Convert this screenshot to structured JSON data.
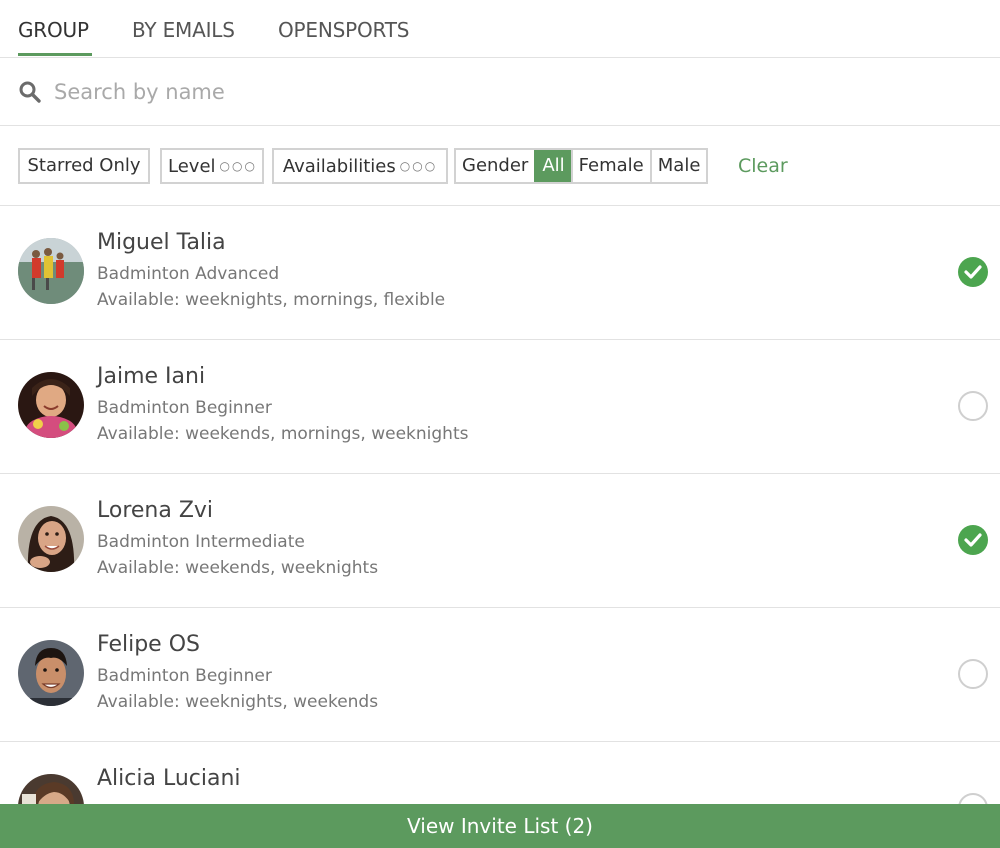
{
  "tabs": [
    {
      "label": "GROUP",
      "active": true
    },
    {
      "label": "BY EMAILS",
      "active": false
    },
    {
      "label": "OPENSPORTS",
      "active": false
    }
  ],
  "search": {
    "placeholder": "Search by name",
    "icon": "search-icon"
  },
  "filters": {
    "starred": "Starred Only",
    "level": "Level",
    "availabilities": "Availabilities",
    "dots": "○○○",
    "gender_label": "Gender",
    "gender_options": [
      "All",
      "Female",
      "Male"
    ],
    "gender_selected": "All",
    "clear": "Clear"
  },
  "players": [
    {
      "name": "Miguel Talia",
      "level": "Badminton Advanced",
      "availability": "Available: weeknights, mornings, flexible",
      "selected": true
    },
    {
      "name": "Jaime Iani",
      "level": "Badminton Beginner",
      "availability": "Available: weekends, mornings, weeknights",
      "selected": false
    },
    {
      "name": "Lorena Zvi",
      "level": "Badminton Intermediate",
      "availability": "Available: weekends, weeknights",
      "selected": true
    },
    {
      "name": "Felipe OS",
      "level": "Badminton Beginner",
      "availability": "Available: weeknights, weekends",
      "selected": false
    },
    {
      "name": "Alicia Luciani",
      "level": "",
      "availability": "",
      "selected": false
    }
  ],
  "footer": {
    "label": "View Invite List (2)"
  },
  "colors": {
    "accent": "#5c9a5e",
    "check": "#4ca54f",
    "divider": "#e2e2e2"
  }
}
